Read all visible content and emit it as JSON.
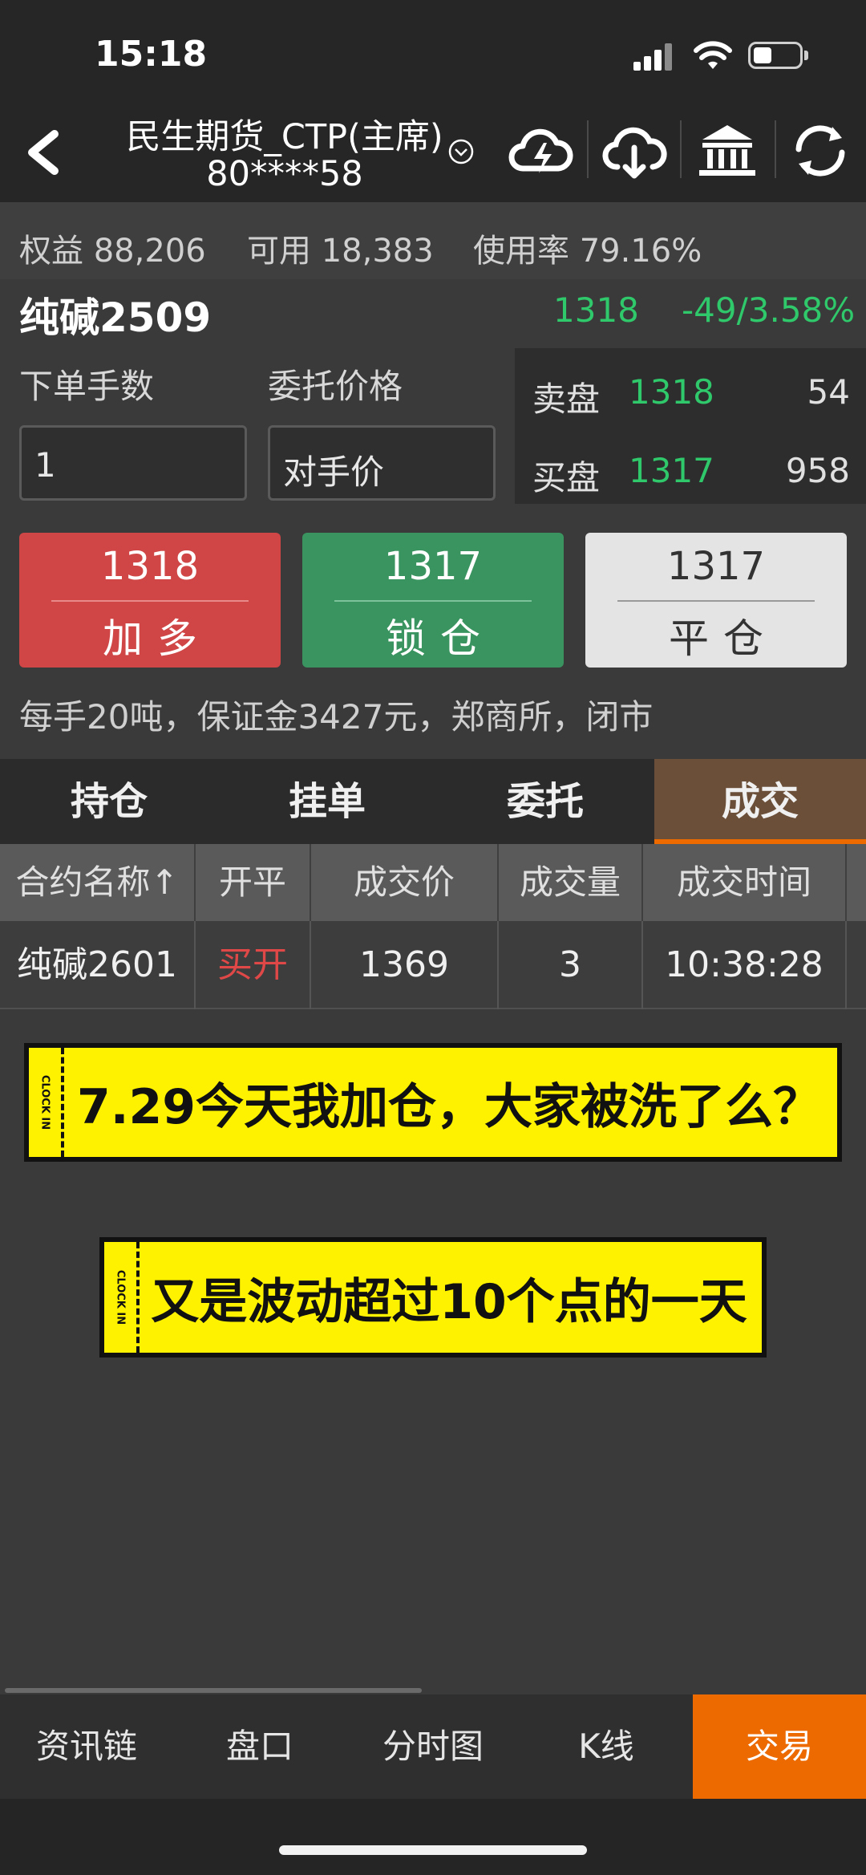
{
  "status": {
    "time": "15:18"
  },
  "header": {
    "broker": "民生期货_CTP(主席)",
    "account": "80****58",
    "icons": [
      "cloud-lightning-icon",
      "cloud-download-icon",
      "bank-icon",
      "refresh-icon"
    ]
  },
  "account": {
    "equity": "权益 88,206",
    "available": "可用 18,383",
    "usage": "使用率 79.16%"
  },
  "contract": {
    "name": "纯碱2509",
    "price": "1318",
    "change": "-49/3.58%"
  },
  "order_form": {
    "qty_label": "下单手数",
    "price_label": "委托价格",
    "qty_value": "1",
    "price_value": "对手价"
  },
  "depth": {
    "ask": {
      "label": "卖盘",
      "price": "1318",
      "volume": "54"
    },
    "bid": {
      "label": "买盘",
      "price": "1317",
      "volume": "958"
    }
  },
  "actions": [
    {
      "price": "1318",
      "label": "加多"
    },
    {
      "price": "1317",
      "label": "锁仓"
    },
    {
      "price": "1317",
      "label": "平仓"
    }
  ],
  "contract_info": "每手20吨，保证金3427元，郑商所，闭市",
  "tabs": [
    "持仓",
    "挂单",
    "委托",
    "成交"
  ],
  "active_tab": "成交",
  "table": {
    "headers": [
      "合约名称↑",
      "开平",
      "成交价",
      "成交量",
      "成交时间"
    ],
    "rows": [
      [
        "纯碱2601",
        "买开",
        "1369",
        "3",
        "10:38:28"
      ]
    ]
  },
  "banners": {
    "stub_text": "CLOCK IN",
    "line1": "7.29今天我加仓，大家被洗了么？",
    "line2": "又是波动超过10个点的一天"
  },
  "bottom_nav": [
    "资讯链",
    "盘口",
    "分时图",
    "K线",
    "交易"
  ],
  "active_nav": "交易",
  "colors": {
    "up_red": "#d04646",
    "down_green": "#2fc86a",
    "buy_button": "#d04646",
    "lock_button": "#3a9460",
    "close_button": "#e4e4e4",
    "active_tab": "#6b4f38",
    "active_nav": "#ec6a00",
    "banner": "#fff200"
  }
}
